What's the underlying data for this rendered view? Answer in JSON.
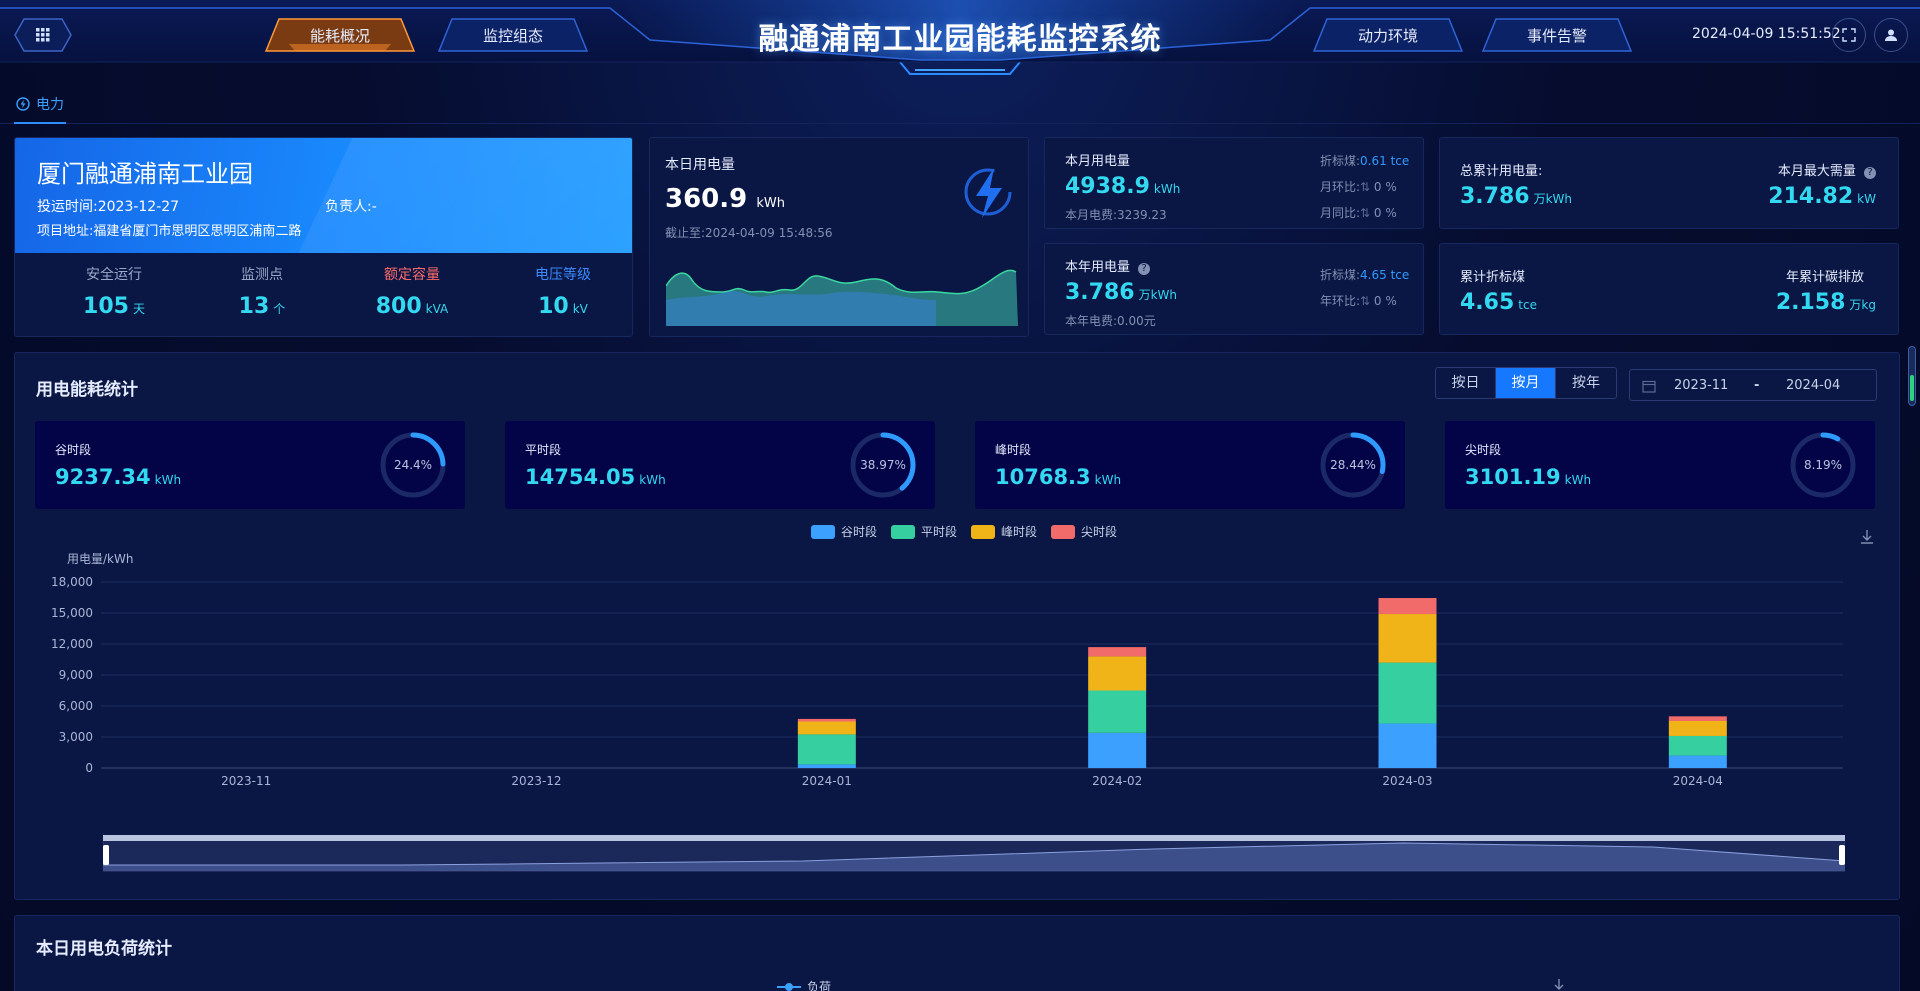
{
  "header": {
    "title": "融通浦南工业园能耗监控系统",
    "nav_left": [
      "能耗概况",
      "监控组态"
    ],
    "nav_right": [
      "动力环境",
      "事件告警"
    ],
    "active_nav": "能耗概况",
    "datetime": "2024-04-09 15:51:52",
    "icons": [
      "grid-menu-icon",
      "fullscreen-icon",
      "user-icon"
    ]
  },
  "tabs": [
    {
      "label": "电力",
      "icon": "power-icon",
      "active": true
    }
  ],
  "project": {
    "name": "厦门融通浦南工业园",
    "commission": "投运时间:2023-12-27",
    "owner": "负责人:-",
    "address": "项目地址:福建省厦门市思明区思明区浦南二路",
    "stats": [
      {
        "label": "安全运行",
        "value": "105",
        "unit": "天",
        "color": "#9aa8c9"
      },
      {
        "label": "监测点",
        "value": "13",
        "unit": "个",
        "color": "#9aa8c9"
      },
      {
        "label": "额定容量",
        "value": "800",
        "unit": "kVA",
        "color": "#ff6b6b"
      },
      {
        "label": "电压等级",
        "value": "10",
        "unit": "kV",
        "color": "#3a8bff"
      }
    ]
  },
  "today": {
    "label": "本日用电量",
    "value": "360.9",
    "unit": "kWh",
    "asof": "截止至:2024-04-09 15:48:56",
    "icon": "lightning-icon"
  },
  "month": {
    "label": "本月用电量",
    "value": "4938.9",
    "unit": "kWh",
    "fee": "本月电费:3239.23",
    "coal_label": "折标煤:",
    "coal_value": "0.61 tce",
    "mom": "月环比:",
    "mom_val": "0 %",
    "yoy": "月同比:",
    "yoy_val": "0 %"
  },
  "year": {
    "label": "本年用电量",
    "value": "3.786",
    "unit": "万kWh",
    "fee": "本年电费:0.00元",
    "coal_label": "折标煤:",
    "coal_value": "4.65 tce",
    "yoy": "年环比:",
    "yoy_val": "0 %"
  },
  "totals": {
    "total_label": "总累计用电量:",
    "total_value": "3.786",
    "total_unit": "万kWh",
    "maxdemand_label": "本月最大需量",
    "maxdemand_value": "214.82",
    "maxdemand_unit": "kW",
    "coal_label": "累计折标煤",
    "coal_value": "4.65",
    "coal_unit": "tce",
    "carbon_label": "年累计碳排放",
    "carbon_value": "2.158",
    "carbon_unit": "万kg"
  },
  "section": {
    "title": "用电能耗统计",
    "modes": [
      "按日",
      "按月",
      "按年"
    ],
    "active_mode": "按月",
    "date_from": "2023-11",
    "date_sep": "-",
    "date_to": "2024-04"
  },
  "kpis": [
    {
      "label": "谷时段",
      "value": "9237.34",
      "unit": "kWh",
      "pct": "24.4%",
      "frac": 0.244
    },
    {
      "label": "平时段",
      "value": "14754.05",
      "unit": "kWh",
      "pct": "38.97%",
      "frac": 0.3897
    },
    {
      "label": "峰时段",
      "value": "10768.3",
      "unit": "kWh",
      "pct": "28.44%",
      "frac": 0.2844
    },
    {
      "label": "尖时段",
      "value": "3101.19",
      "unit": "kWh",
      "pct": "8.19%",
      "frac": 0.0819
    }
  ],
  "colors": {
    "valley": "#3ba0ff",
    "flat": "#36cfa0",
    "peak": "#f0b418",
    "sharp": "#f26b6b",
    "accent": "#1677ff"
  },
  "chart_data": {
    "type": "bar",
    "stacked": true,
    "ylabel": "用电量/kWh",
    "ylim": [
      0,
      18000
    ],
    "yticks": [
      "0",
      "3,000",
      "6,000",
      "9,000",
      "12,000",
      "15,000",
      "18,000"
    ],
    "categories": [
      "2023-11",
      "2023-12",
      "2024-01",
      "2024-02",
      "2024-03",
      "2024-04"
    ],
    "series": [
      {
        "name": "谷时段",
        "values": [
          0,
          0,
          350,
          3400,
          4300,
          1200
        ]
      },
      {
        "name": "平时段",
        "values": [
          0,
          0,
          2900,
          4100,
          5900,
          1900
        ]
      },
      {
        "name": "峰时段",
        "values": [
          0,
          0,
          1250,
          3300,
          4700,
          1450
        ]
      },
      {
        "name": "尖时段",
        "values": [
          0,
          0,
          250,
          900,
          1550,
          450
        ]
      }
    ],
    "legend": "top-center",
    "grid": true
  },
  "load": {
    "title": "本日用电负荷统计",
    "legend": "负荷"
  }
}
